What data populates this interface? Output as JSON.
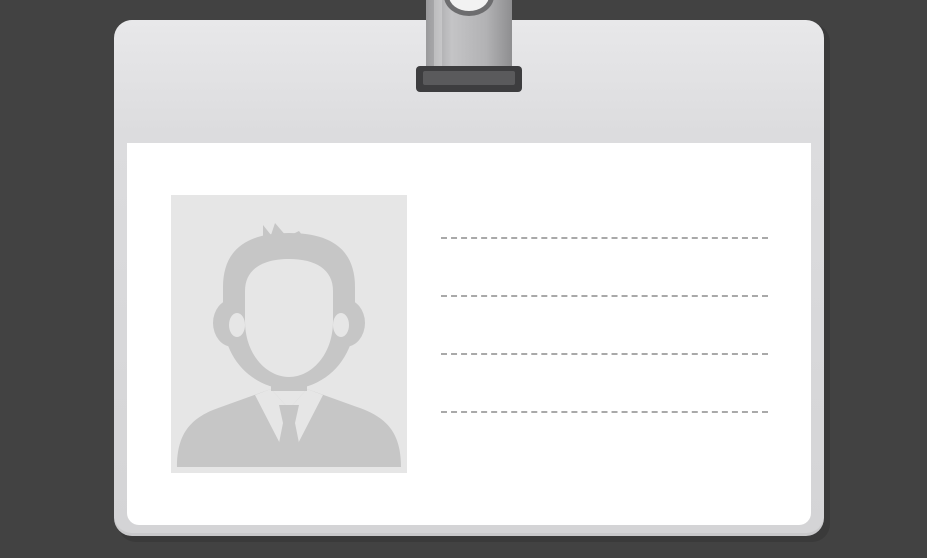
{
  "badge": {
    "field_lines": [
      {
        "id": "line-1",
        "value": ""
      },
      {
        "id": "line-2",
        "value": ""
      },
      {
        "id": "line-3",
        "value": ""
      },
      {
        "id": "line-4",
        "value": ""
      }
    ],
    "photo_icon": "person-silhouette-icon",
    "clip_icon": "badge-clip-icon"
  },
  "colors": {
    "background": "#424242",
    "card": "#dcdcde",
    "insert": "#ffffff",
    "photo_bg": "#e6e6e6",
    "silhouette": "#c6c6c6",
    "dash": "#a9a9a9"
  }
}
